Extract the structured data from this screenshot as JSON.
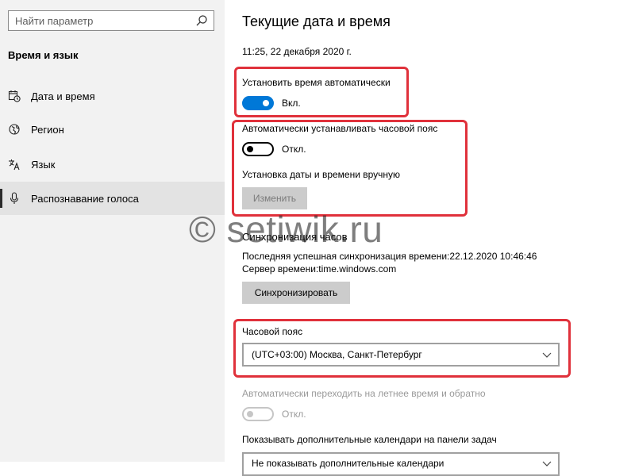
{
  "sidebar": {
    "search_placeholder": "Найти параметр",
    "section_title": "Время и язык",
    "items": [
      {
        "label": "Дата и время",
        "icon": "calendar-clock-icon",
        "selected": false
      },
      {
        "label": "Регион",
        "icon": "globe-icon",
        "selected": false
      },
      {
        "label": "Язык",
        "icon": "language-icon",
        "selected": false
      },
      {
        "label": "Распознавание голоса",
        "icon": "microphone-icon",
        "selected": true
      }
    ]
  },
  "main": {
    "title": "Текущие дата и время",
    "current_datetime": "11:25, 22 декабря 2020 г.",
    "auto_time": {
      "label": "Установить время автоматически",
      "state": "Вкл.",
      "on": true
    },
    "auto_timezone": {
      "label": "Автоматически устанавливать часовой пояс",
      "state": "Откл.",
      "on": false
    },
    "manual": {
      "label": "Установка даты и времени вручную",
      "button": "Изменить"
    },
    "sync": {
      "title": "Синхронизация часов",
      "last_sync": "Последняя успешная синхронизация времени:22.12.2020 10:46:46",
      "server": "Сервер времени:time.windows.com",
      "button": "Синхронизировать"
    },
    "timezone": {
      "label": "Часовой пояс",
      "value": "(UTC+03:00) Москва, Санкт-Петербург"
    },
    "dst": {
      "label": "Автоматически переходить на летнее время и обратно",
      "state": "Откл.",
      "on": false,
      "disabled": true
    },
    "calendars": {
      "label": "Показывать дополнительные календари на панели задач",
      "value": "Не показывать дополнительные календари"
    }
  },
  "watermark": "© setiwik.ru",
  "colors": {
    "accent": "#0078d7",
    "highlight": "#e0313b",
    "sidebar_bg": "#f2f2f2"
  }
}
